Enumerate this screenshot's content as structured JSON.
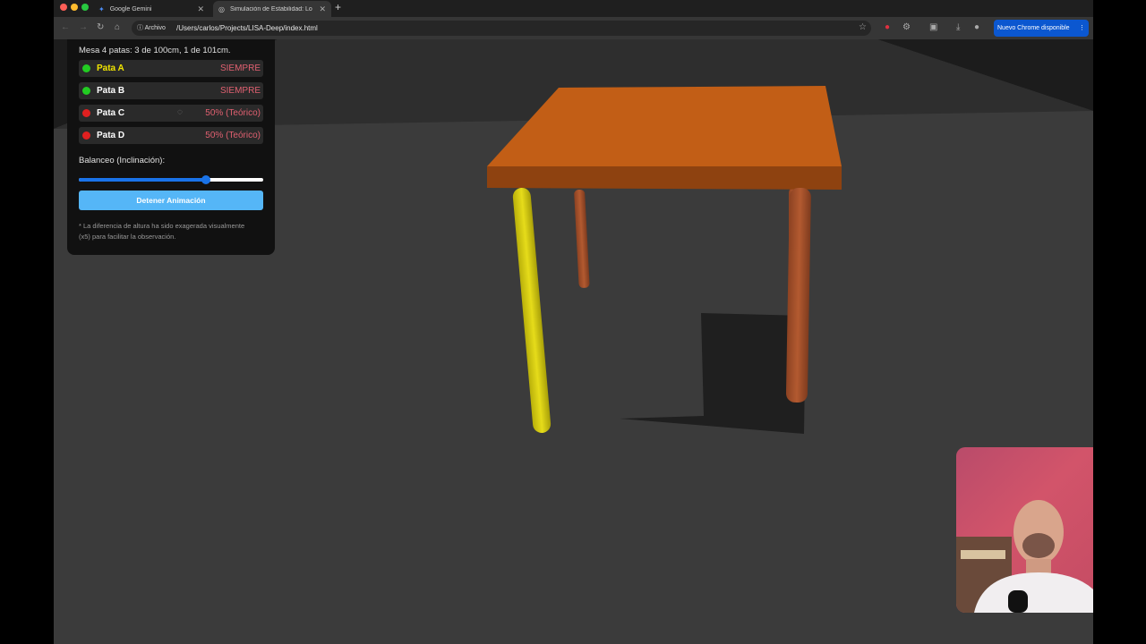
{
  "browser": {
    "tabs": [
      {
        "title": "Google Gemini",
        "active": false
      },
      {
        "title": "Simulación de Estabilidad: Lo",
        "active": true
      }
    ],
    "file_chip": "Archivo",
    "url": "/Users/carlos/Projects/LISA-Deep/index.html",
    "update_label": "Nuevo Chrome disponible"
  },
  "panel": {
    "title": "Mesa 4 patas: 3 de 100cm, 1 de 101cm.",
    "legs": [
      {
        "name": "Pata A",
        "status": "SIEMPRE",
        "dot_color": "#22cc22",
        "name_color": "#f2e600"
      },
      {
        "name": "Pata B",
        "status": "SIEMPRE",
        "dot_color": "#22cc22",
        "name_color": "#ffffff"
      },
      {
        "name": "Pata C",
        "status": "50% (Teórico)",
        "dot_color": "#e02020",
        "name_color": "#ffffff"
      },
      {
        "name": "Pata D",
        "status": "50% (Teórico)",
        "dot_color": "#e02020",
        "name_color": "#ffffff"
      }
    ],
    "slider_label": "Balanceo (Inclinación):",
    "slider_value_fraction": 0.69,
    "stop_button": "Detener Animación",
    "note": "* La diferencia de altura ha sido exagerada visualmente (x5) para facilitar la observación."
  },
  "colors": {
    "table_top": "#c25e16",
    "leg_brown": "#a5502b",
    "leg_yellow": "#d6cc10",
    "accent_blue": "#1a73e8",
    "button_blue": "#55b6f7"
  }
}
